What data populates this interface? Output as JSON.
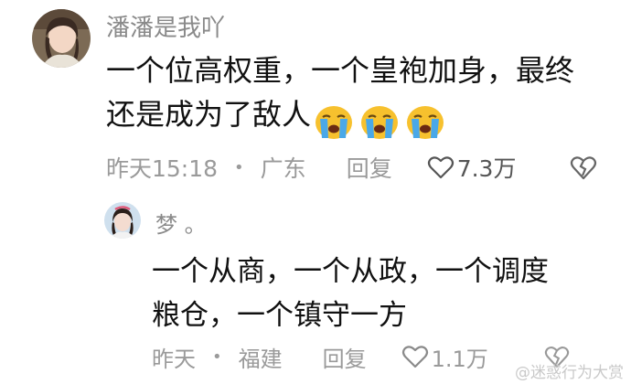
{
  "comments": [
    {
      "username": "潘潘是我吖",
      "text_lines": [
        "一个位高权重，一个皇袍加身，最终",
        "还是成为了敌人"
      ],
      "emoji": [
        "crying-face",
        "crying-face",
        "crying-face"
      ],
      "time": "昨天15:18",
      "dot": "•",
      "location": "广东",
      "reply_label": "回复",
      "like_count": "7.3万"
    },
    {
      "username": "梦 。",
      "text_lines": [
        "一个从商，一个从政，一个调度",
        "粮仓，一个镇守一方"
      ],
      "time": "昨天",
      "dot": "•",
      "location": "福建",
      "reply_label": "回复",
      "like_count": "1.1万"
    }
  ],
  "watermark": "@迷惑行为大赏",
  "colors": {
    "meta_gray": "#9a9a9a",
    "text": "#111111",
    "emoji_yellow": "#f7c12e",
    "tear_blue": "#4aa8e8"
  }
}
